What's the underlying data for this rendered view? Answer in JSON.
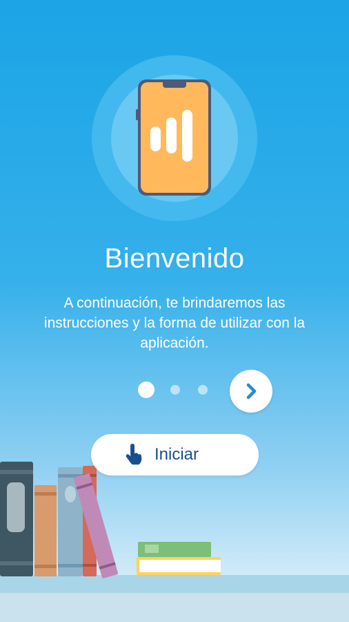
{
  "onboarding": {
    "title": "Bienvenido",
    "description": "A continuación, te brindaremos las instrucciones y la forma de utilizar con la aplicación.",
    "pager": {
      "total_pages": 3,
      "current_page": 1
    },
    "next_icon": "chevron-right-icon",
    "start_button": {
      "label": "Iniciar",
      "icon": "tap-hand-icon"
    }
  },
  "colors": {
    "background_top": "#1ba4e6",
    "background_bottom": "#e2f2fa",
    "accent_text": "#16508f",
    "phone_screen": "#ffb95c",
    "phone_frame": "#4d5a7a"
  }
}
